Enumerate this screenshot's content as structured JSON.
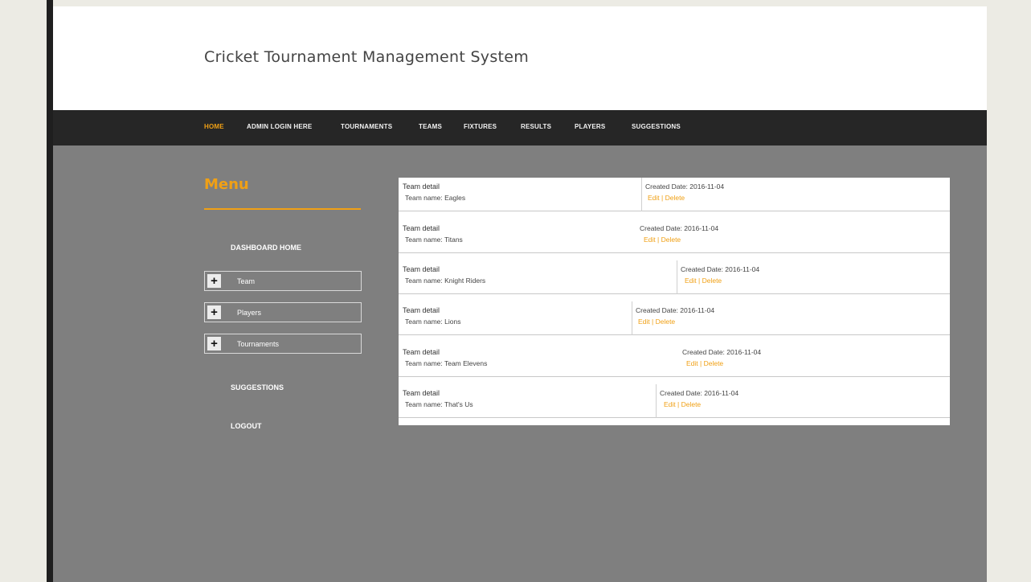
{
  "header": {
    "title": "Cricket Tournament Management System"
  },
  "nav": {
    "items": [
      "HOME",
      "ADMIN LOGIN HERE",
      "TOURNAMENTS",
      "TEAMS",
      "FIXTURES",
      "RESULTS",
      "PLAYERS",
      "SUGGESTIONS"
    ],
    "active": "HOME"
  },
  "sidebar": {
    "heading": "Menu",
    "dashboard": "DASHBOARD HOME",
    "accordions": [
      {
        "icon": "plus-icon",
        "label": "Team"
      },
      {
        "icon": "plus-icon",
        "label": "Players"
      },
      {
        "icon": "plus-icon",
        "label": "Tournaments"
      }
    ],
    "suggestions": "SUGGESTIONS",
    "logout": "LOGOUT"
  },
  "teams": [
    {
      "title": "Team detail",
      "name": "Team name: Eagles",
      "date": "Created Date: 2016-11-04",
      "edit": "Edit",
      "sep": " | ",
      "delete": "Delete"
    },
    {
      "title": "Team detail",
      "name": "Team name: Titans",
      "date": "Created Date: 2016-11-04",
      "edit": "Edit",
      "sep": " | ",
      "delete": "Delete"
    },
    {
      "title": "Team detail",
      "name": "Team name: Knight Riders",
      "date": "Created Date: 2016-11-04",
      "edit": "Edit",
      "sep": " | ",
      "delete": "Delete"
    },
    {
      "title": "Team detail",
      "name": "Team name: Lions",
      "date": "Created Date: 2016-11-04",
      "edit": "Edit",
      "sep": " | ",
      "delete": "Delete"
    },
    {
      "title": "Team detail",
      "name": "Team name: Team Elevens",
      "date": "Created Date: 2016-11-04",
      "edit": "Edit",
      "sep": " | ",
      "delete": "Delete"
    },
    {
      "title": "Team detail",
      "name": "Team name: That's Us",
      "date": "Created Date: 2016-11-04",
      "edit": "Edit",
      "sep": " | ",
      "delete": "Delete"
    }
  ],
  "colors": {
    "accent": "#f0a015",
    "navbar": "#262626",
    "body": "#7f7f7f"
  }
}
